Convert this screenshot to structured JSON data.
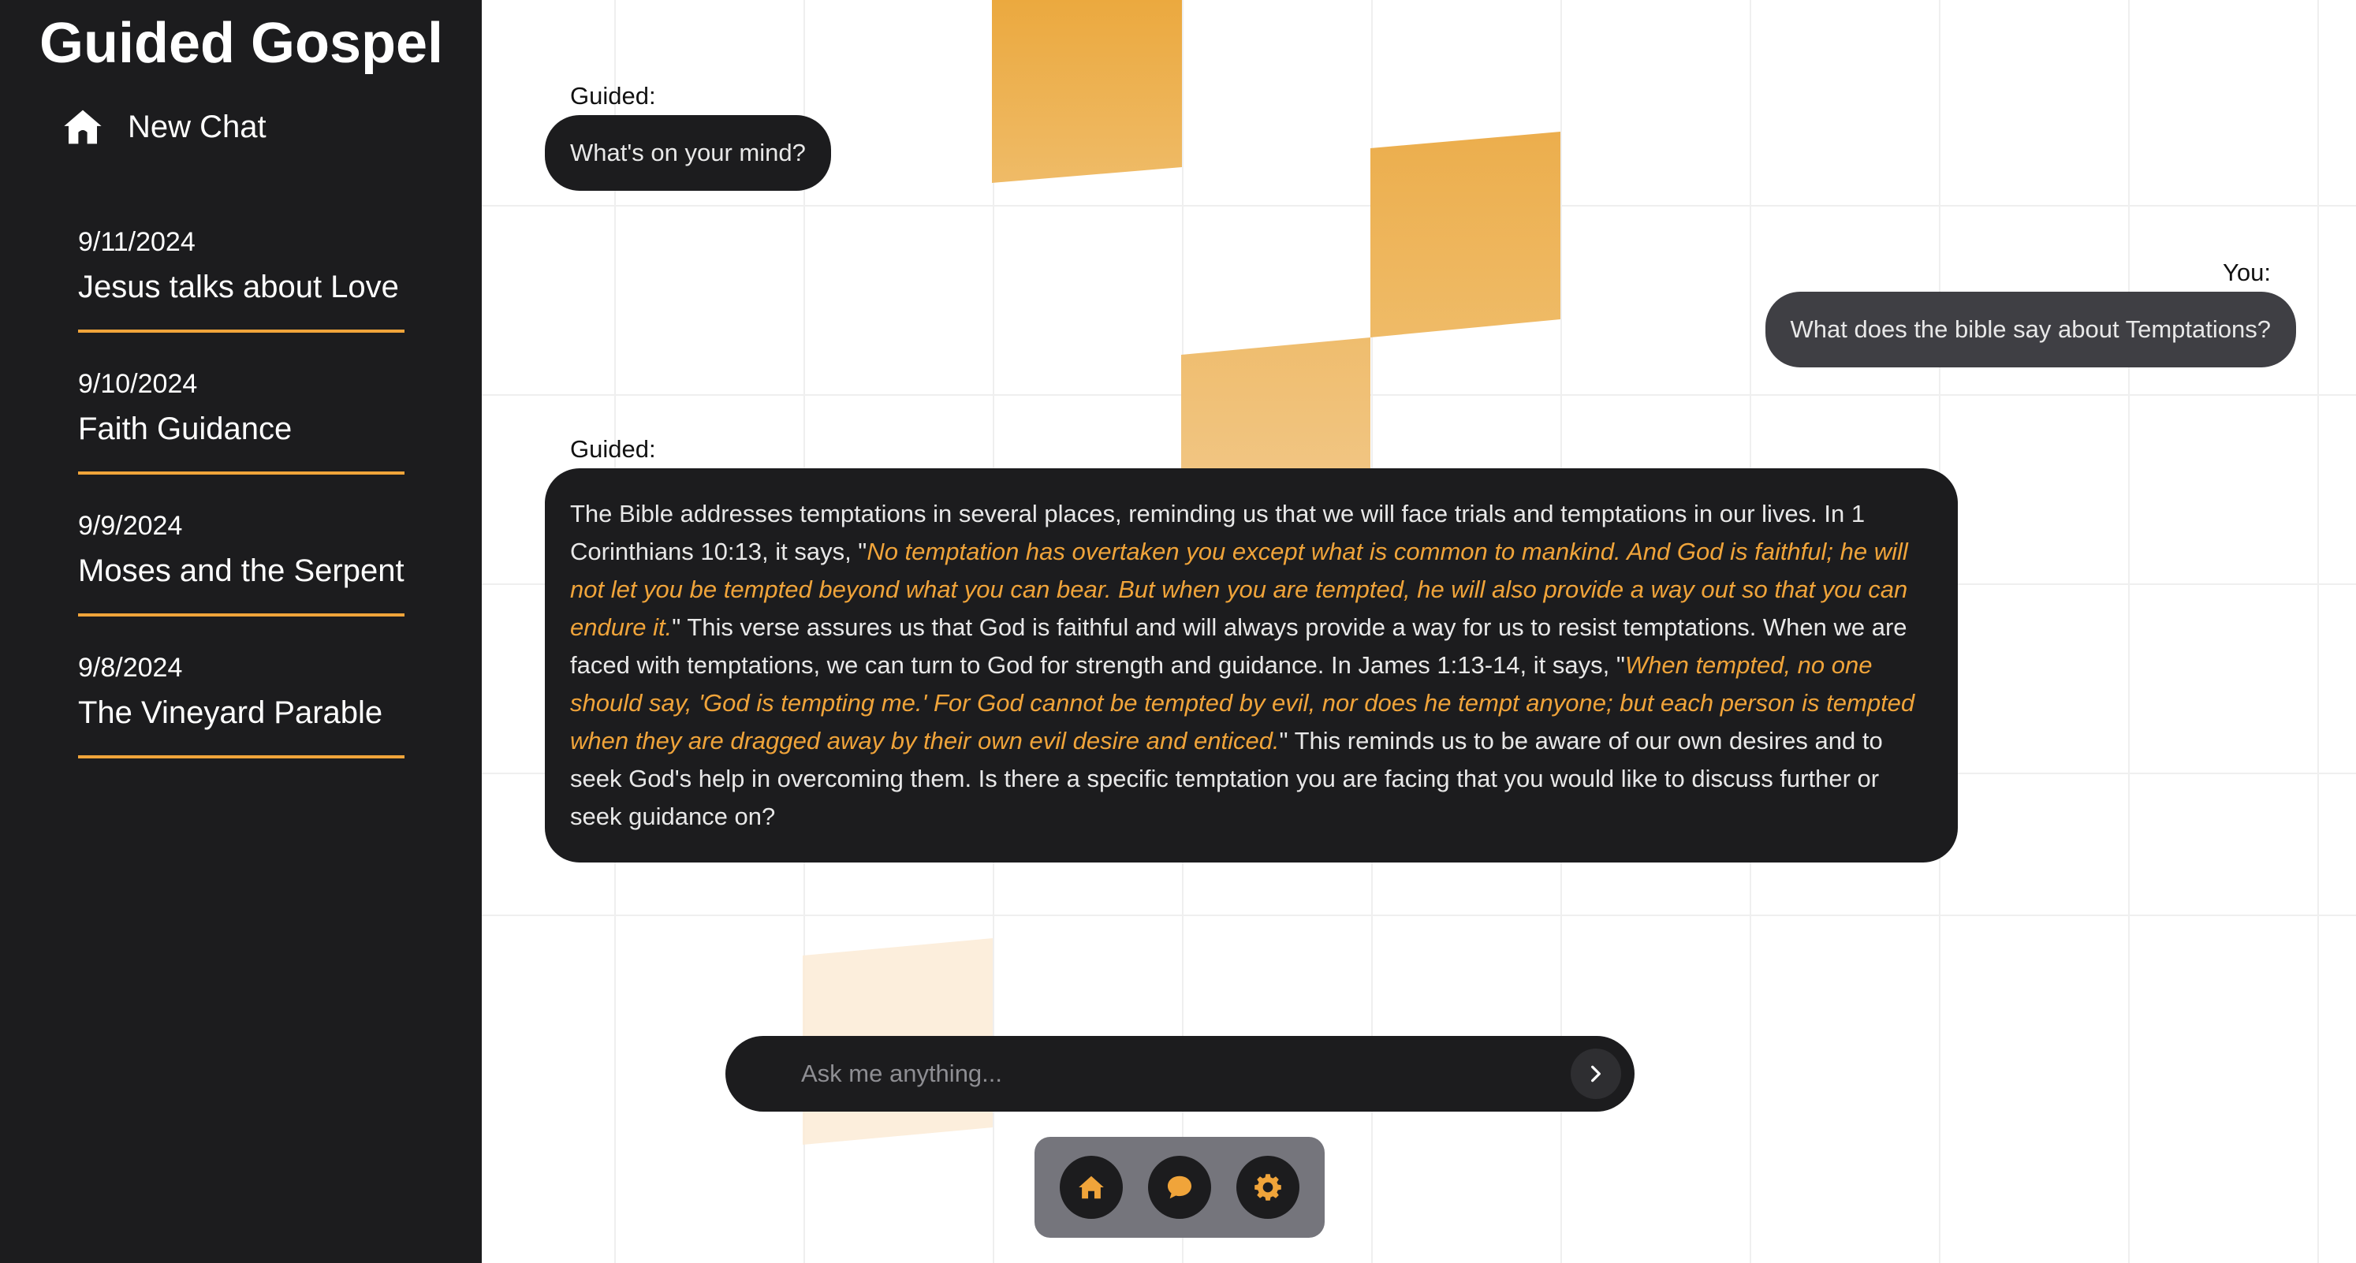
{
  "app": {
    "title": "Guided Gospel"
  },
  "sidebar": {
    "new_chat_label": "New Chat",
    "new_chat_icon": "home-icon",
    "history": [
      {
        "date": "9/11/2024",
        "title": "Jesus talks about Love"
      },
      {
        "date": "9/10/2024",
        "title": "Faith Guidance"
      },
      {
        "date": "9/9/2024",
        "title": "Moses and the Serpent"
      },
      {
        "date": "9/8/2024",
        "title": "The Vineyard Parable"
      }
    ]
  },
  "chat": {
    "messages": [
      {
        "speaker": "Guided:",
        "text": "What's on your mind?"
      },
      {
        "speaker": "You:",
        "text": "What does the bible say about Temptations?"
      },
      {
        "speaker": "Guided:",
        "part1": "The Bible addresses temptations in several places, reminding us that we will face trials and temptations in our lives. In 1 Corinthians 10:13, it says, \"",
        "verse1": "No temptation has overtaken you except what is common to mankind. And God is faithful; he will not let you be tempted beyond what you can bear. But when you are tempted, he will also provide a way out so that you can endure it.",
        "part2": "\" This verse assures us that God is faithful and will always provide a way for us to resist temptations. When we are faced with temptations, we can turn to God for strength and guidance. In James 1:13-14, it says, \"",
        "verse2": "When tempted, no one should say, 'God is tempting me.' For God cannot be tempted by evil, nor does he tempt anyone; but each person is tempted when they are dragged away by their own evil desire and enticed.",
        "part3": "\" This reminds us to be aware of our own desires and to seek God's help in overcoming them. Is there a specific temptation you are facing that you would like to discuss further or seek guidance on?"
      }
    ]
  },
  "input": {
    "placeholder": "Ask me anything...",
    "value": "",
    "send_icon": "chevron-right-icon"
  },
  "bottom_nav": {
    "items": [
      "home-icon",
      "chat-bubble-icon",
      "gear-icon"
    ]
  },
  "colors": {
    "accent": "#f0a43a",
    "sidebar_bg": "#1c1c1e",
    "guided_bubble": "#1c1c1e",
    "user_bubble": "#3f3f44",
    "nav_bg": "#75757c"
  }
}
